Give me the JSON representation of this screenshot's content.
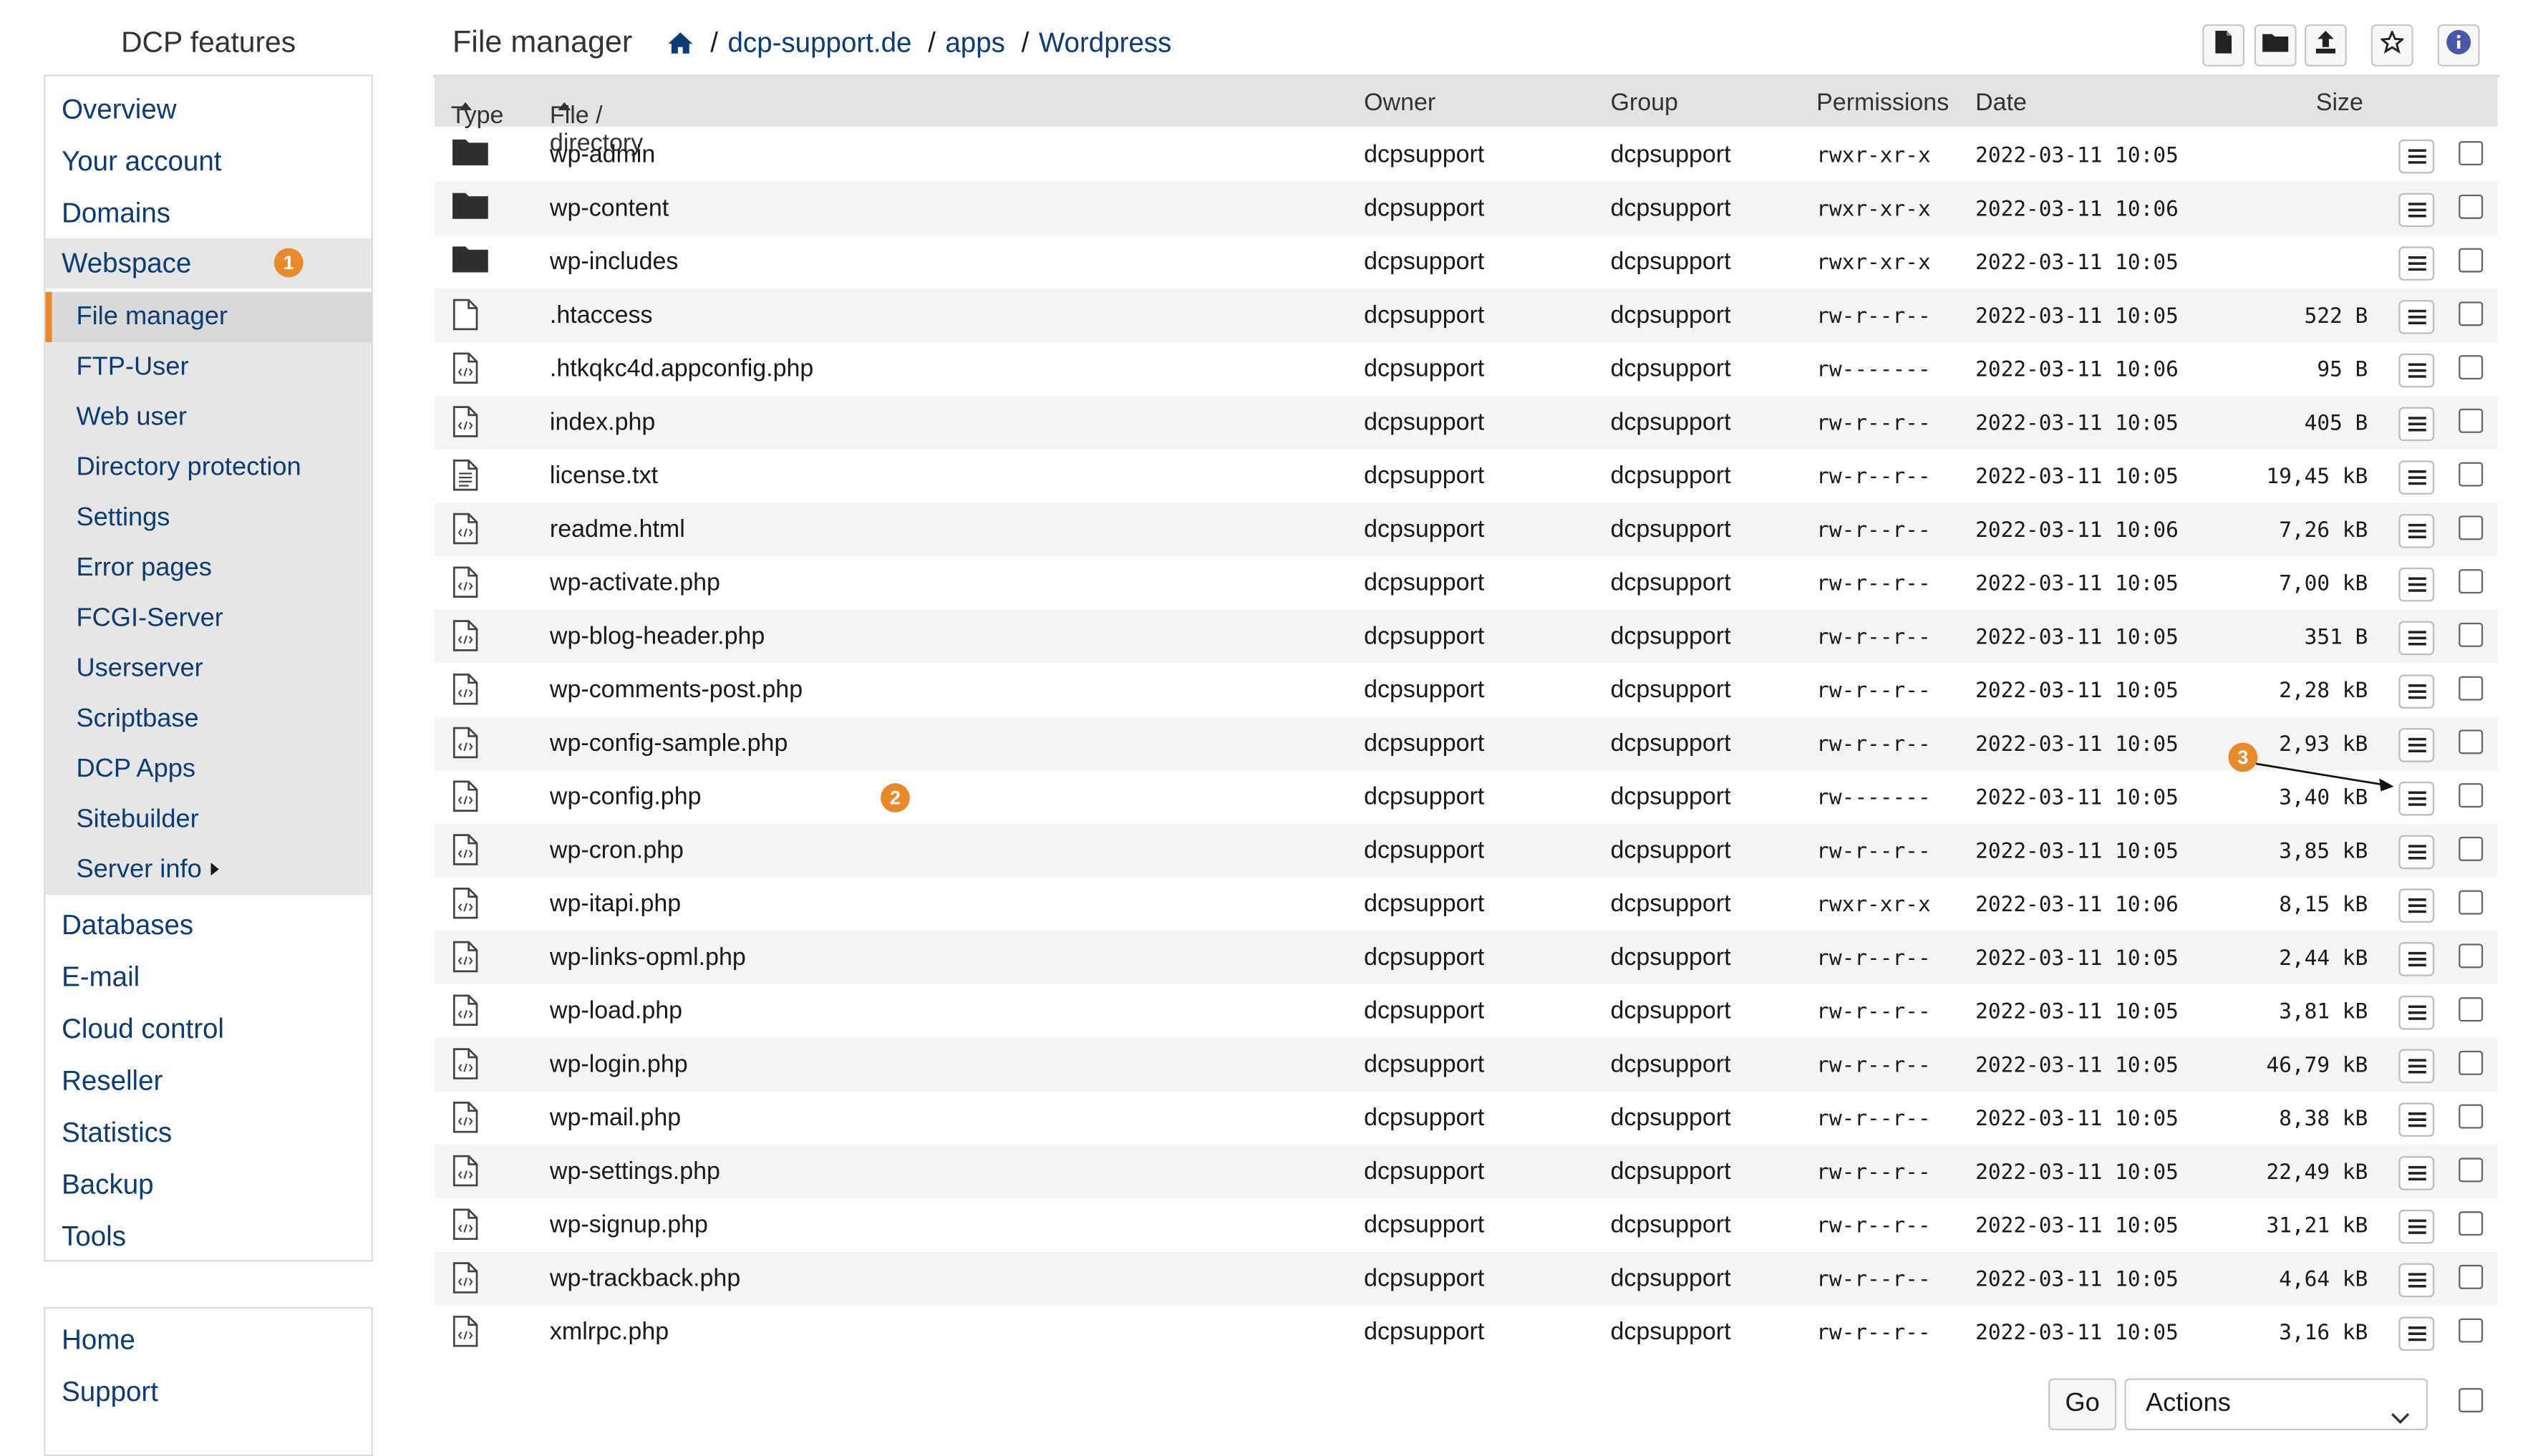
{
  "sidebar": {
    "title": "DCP features",
    "main_items": [
      {
        "label": "Overview"
      },
      {
        "label": "Your account"
      },
      {
        "label": "Domains"
      },
      {
        "label": "Webspace",
        "badge": "1"
      }
    ],
    "webspace_subitems": [
      {
        "label": "File manager"
      },
      {
        "label": "FTP-User"
      },
      {
        "label": "Web user"
      },
      {
        "label": "Directory protection"
      },
      {
        "label": "Settings"
      },
      {
        "label": "Error pages"
      },
      {
        "label": "FCGI-Server"
      },
      {
        "label": "Userserver"
      },
      {
        "label": "Scriptbase"
      },
      {
        "label": "DCP Apps"
      },
      {
        "label": "Sitebuilder"
      },
      {
        "label": "Server info"
      }
    ],
    "more_items": [
      {
        "label": "Databases"
      },
      {
        "label": "E-mail"
      },
      {
        "label": "Cloud control"
      },
      {
        "label": "Reseller"
      },
      {
        "label": "Statistics"
      },
      {
        "label": "Backup"
      },
      {
        "label": "Tools"
      }
    ],
    "secondary_items": [
      {
        "label": "Home"
      },
      {
        "label": "Support"
      }
    ]
  },
  "header": {
    "title": "File manager",
    "breadcrumb": [
      "dcp-support.de",
      "apps",
      "Wordpress"
    ],
    "toolbar_icons": [
      "new-file-icon",
      "new-folder-icon",
      "upload-icon",
      "favorite-star-icon",
      "info-icon"
    ]
  },
  "table": {
    "columns": {
      "type": "Type",
      "name": "File / directory",
      "owner": "Owner",
      "group": "Group",
      "permissions": "Permissions",
      "date": "Date",
      "size": "Size"
    },
    "rows": [
      {
        "icon": "folder",
        "name": "wp-admin",
        "owner": "dcpsupport",
        "group": "dcpsupport",
        "perm": "rwxr-xr-x",
        "date": "2022-03-11 10:05",
        "size": ""
      },
      {
        "icon": "folder",
        "name": "wp-content",
        "owner": "dcpsupport",
        "group": "dcpsupport",
        "perm": "rwxr-xr-x",
        "date": "2022-03-11 10:06",
        "size": ""
      },
      {
        "icon": "folder",
        "name": "wp-includes",
        "owner": "dcpsupport",
        "group": "dcpsupport",
        "perm": "rwxr-xr-x",
        "date": "2022-03-11 10:05",
        "size": ""
      },
      {
        "icon": "file",
        "name": ".htaccess",
        "owner": "dcpsupport",
        "group": "dcpsupport",
        "perm": "rw-r--r--",
        "date": "2022-03-11 10:05",
        "size": "522 B"
      },
      {
        "icon": "code",
        "name": ".htkqkc4d.appconfig.php",
        "owner": "dcpsupport",
        "group": "dcpsupport",
        "perm": "rw-------",
        "date": "2022-03-11 10:06",
        "size": "95 B"
      },
      {
        "icon": "code",
        "name": "index.php",
        "owner": "dcpsupport",
        "group": "dcpsupport",
        "perm": "rw-r--r--",
        "date": "2022-03-11 10:05",
        "size": "405 B"
      },
      {
        "icon": "text",
        "name": "license.txt",
        "owner": "dcpsupport",
        "group": "dcpsupport",
        "perm": "rw-r--r--",
        "date": "2022-03-11 10:05",
        "size": "19,45 kB"
      },
      {
        "icon": "code",
        "name": "readme.html",
        "owner": "dcpsupport",
        "group": "dcpsupport",
        "perm": "rw-r--r--",
        "date": "2022-03-11 10:06",
        "size": "7,26 kB"
      },
      {
        "icon": "code",
        "name": "wp-activate.php",
        "owner": "dcpsupport",
        "group": "dcpsupport",
        "perm": "rw-r--r--",
        "date": "2022-03-11 10:05",
        "size": "7,00 kB"
      },
      {
        "icon": "code",
        "name": "wp-blog-header.php",
        "owner": "dcpsupport",
        "group": "dcpsupport",
        "perm": "rw-r--r--",
        "date": "2022-03-11 10:05",
        "size": "351 B"
      },
      {
        "icon": "code",
        "name": "wp-comments-post.php",
        "owner": "dcpsupport",
        "group": "dcpsupport",
        "perm": "rw-r--r--",
        "date": "2022-03-11 10:05",
        "size": "2,28 kB"
      },
      {
        "icon": "code",
        "name": "wp-config-sample.php",
        "owner": "dcpsupport",
        "group": "dcpsupport",
        "perm": "rw-r--r--",
        "date": "2022-03-11 10:05",
        "size": "2,93 kB"
      },
      {
        "icon": "code",
        "name": "wp-config.php",
        "owner": "dcpsupport",
        "group": "dcpsupport",
        "perm": "rw-------",
        "date": "2022-03-11 10:05",
        "size": "3,40 kB"
      },
      {
        "icon": "code",
        "name": "wp-cron.php",
        "owner": "dcpsupport",
        "group": "dcpsupport",
        "perm": "rw-r--r--",
        "date": "2022-03-11 10:05",
        "size": "3,85 kB"
      },
      {
        "icon": "code",
        "name": "wp-itapi.php",
        "owner": "dcpsupport",
        "group": "dcpsupport",
        "perm": "rwxr-xr-x",
        "date": "2022-03-11 10:06",
        "size": "8,15 kB"
      },
      {
        "icon": "code",
        "name": "wp-links-opml.php",
        "owner": "dcpsupport",
        "group": "dcpsupport",
        "perm": "rw-r--r--",
        "date": "2022-03-11 10:05",
        "size": "2,44 kB"
      },
      {
        "icon": "code",
        "name": "wp-load.php",
        "owner": "dcpsupport",
        "group": "dcpsupport",
        "perm": "rw-r--r--",
        "date": "2022-03-11 10:05",
        "size": "3,81 kB"
      },
      {
        "icon": "code",
        "name": "wp-login.php",
        "owner": "dcpsupport",
        "group": "dcpsupport",
        "perm": "rw-r--r--",
        "date": "2022-03-11 10:05",
        "size": "46,79 kB"
      },
      {
        "icon": "code",
        "name": "wp-mail.php",
        "owner": "dcpsupport",
        "group": "dcpsupport",
        "perm": "rw-r--r--",
        "date": "2022-03-11 10:05",
        "size": "8,38 kB"
      },
      {
        "icon": "code",
        "name": "wp-settings.php",
        "owner": "dcpsupport",
        "group": "dcpsupport",
        "perm": "rw-r--r--",
        "date": "2022-03-11 10:05",
        "size": "22,49 kB"
      },
      {
        "icon": "code",
        "name": "wp-signup.php",
        "owner": "dcpsupport",
        "group": "dcpsupport",
        "perm": "rw-r--r--",
        "date": "2022-03-11 10:05",
        "size": "31,21 kB"
      },
      {
        "icon": "code",
        "name": "wp-trackback.php",
        "owner": "dcpsupport",
        "group": "dcpsupport",
        "perm": "rw-r--r--",
        "date": "2022-03-11 10:05",
        "size": "4,64 kB"
      },
      {
        "icon": "code",
        "name": "xmlrpc.php",
        "owner": "dcpsupport",
        "group": "dcpsupport",
        "perm": "rw-r--r--",
        "date": "2022-03-11 10:05",
        "size": "3,16 kB"
      }
    ]
  },
  "annotations": {
    "badge2": "2",
    "badge3": "3"
  },
  "footer": {
    "go_label": "Go",
    "actions_selected": "Actions"
  },
  "colors": {
    "accent": "#e8892b",
    "link": "#0d3b73",
    "header_bg": "#e3e3e3"
  }
}
